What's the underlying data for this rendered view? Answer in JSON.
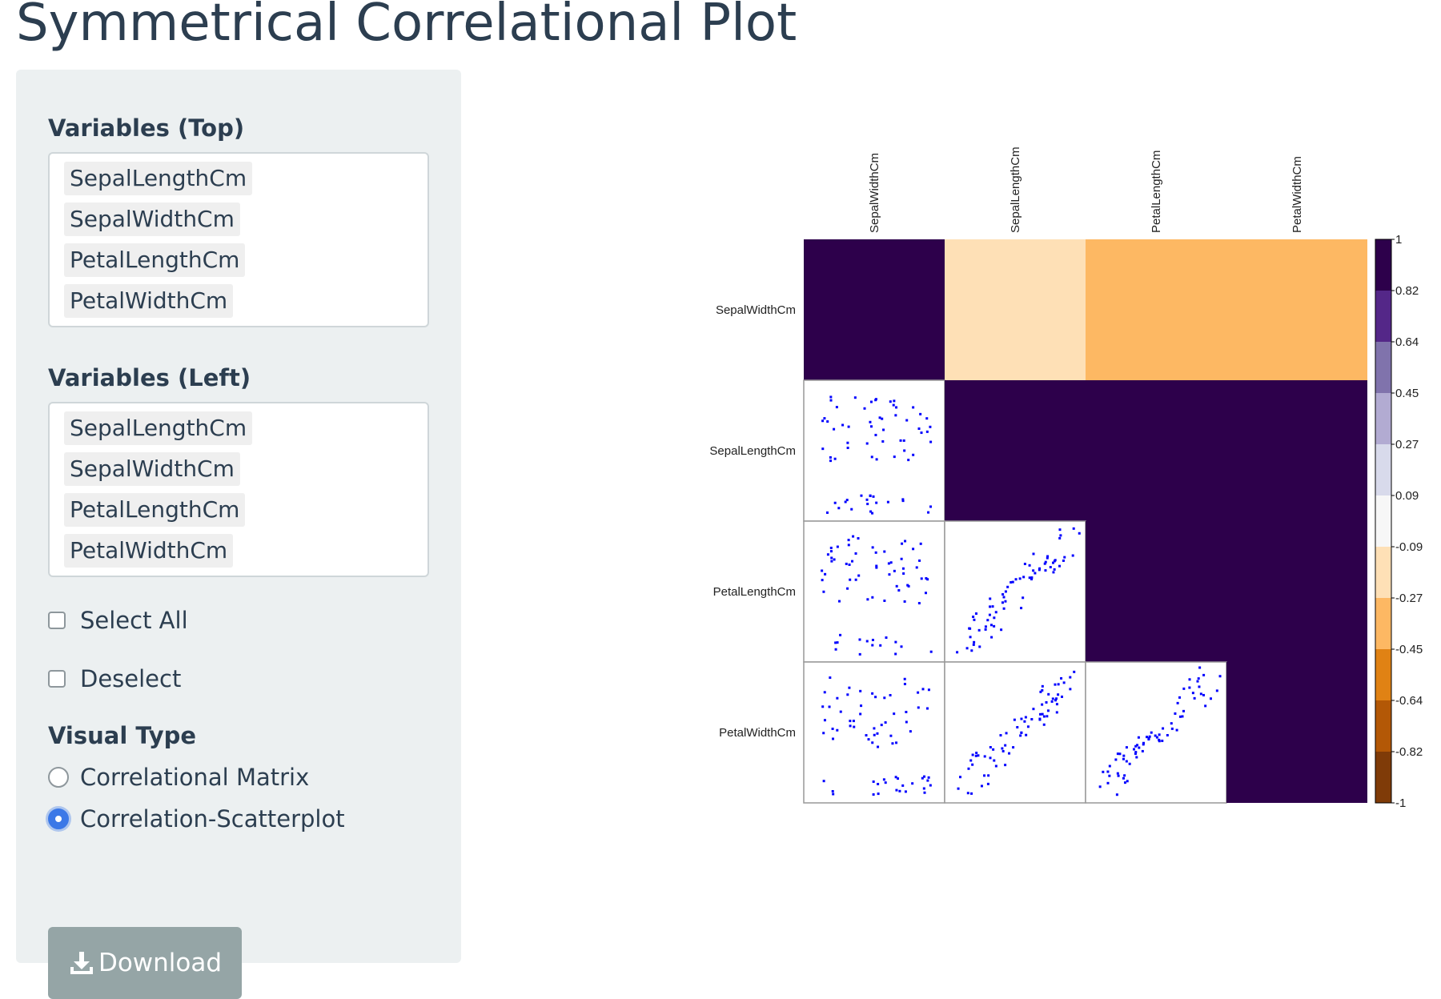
{
  "page": {
    "title": "Symmetrical Correlational Plot"
  },
  "sidebar": {
    "top_label": "Variables (Top)",
    "top_items": [
      "SepalLengthCm",
      "SepalWidthCm",
      "PetalLengthCm",
      "PetalWidthCm"
    ],
    "left_label": "Variables (Left)",
    "left_items": [
      "SepalLengthCm",
      "SepalWidthCm",
      "PetalLengthCm",
      "PetalWidthCm"
    ],
    "select_all_label": "Select All",
    "select_all_checked": false,
    "deselect_label": "Deselect",
    "deselect_checked": false,
    "visual_type_label": "Visual Type",
    "visual_options": [
      "Correlational Matrix",
      "Correlation-Scatterplot"
    ],
    "visual_selected": "Correlation-Scatterplot",
    "download_label": "Download",
    "download_icon": "download-icon"
  },
  "chart_data": {
    "type": "heatmap",
    "subtype": "correlation matrix, upper triangle colored tiles, lower triangle scatterplots",
    "variables": [
      "SepalWidthCm",
      "SepalLengthCm",
      "PetalLengthCm",
      "PetalWidthCm"
    ],
    "correlation": [
      [
        1.0,
        -0.11,
        -0.43,
        -0.37
      ],
      [
        -0.11,
        1.0,
        0.87,
        0.82
      ],
      [
        -0.43,
        0.87,
        1.0,
        0.96
      ],
      [
        -0.37,
        0.82,
        0.96,
        1.0
      ]
    ],
    "colorbar": {
      "ticks": [
        "1",
        "0.82",
        "0.64",
        "0.45",
        "0.27",
        "0.09",
        "-0.09",
        "-0.27",
        "-0.45",
        "-0.64",
        "-0.82",
        "-1"
      ],
      "range": [
        -1,
        1
      ],
      "colors": [
        "#7f3b08",
        "#b35806",
        "#e08214",
        "#fdb863",
        "#fee0b6",
        "#f7f7f7",
        "#d8daeb",
        "#b2abd2",
        "#8073ac",
        "#542788",
        "#2d004b"
      ]
    },
    "scatter_color": "#0000ff"
  }
}
